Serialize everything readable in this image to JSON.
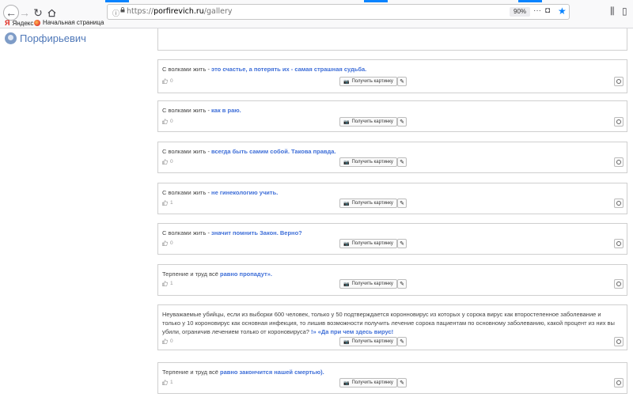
{
  "browser": {
    "url_scheme": "https://",
    "url_host": "porfirevich.ru",
    "url_path": "/gallery",
    "zoom": "90%",
    "bookmarks": [
      {
        "label": "Яндекс"
      },
      {
        "label": "Начальная страница"
      }
    ],
    "colors": {
      "accent": "#0a84ff"
    }
  },
  "site": {
    "logo_text": "Порфирьевич",
    "get_image_label": "Получить картинку"
  },
  "cards": [
    {
      "prompt": "С волками жить - ",
      "generated": "это счастье, а потерять их - самая страшная судьба.",
      "likes": "0"
    },
    {
      "prompt": "С волками жить - ",
      "generated": "как в раю.",
      "likes": "0"
    },
    {
      "prompt": "С волками жить - ",
      "generated": "всегда быть самим собой. Такова правда.",
      "likes": "0"
    },
    {
      "prompt": "С волками жить - ",
      "generated": "не гинекологию учить.",
      "likes": "1"
    },
    {
      "prompt": "С волками жить - ",
      "generated": "значит помнить Закон. Верно?",
      "likes": "0"
    },
    {
      "prompt": "Терпение и труд всё ",
      "generated": "равно пропадут».",
      "likes": "1"
    },
    {
      "prompt": "Неуважаемые убийцы, если из выборки 600 человек, только у 50 подтверждается коронновирус из которых у сорока вирус как второстепенное заболевание и только у 10 короновирус как основная инфекция, то лишив возможности получить лечение сорока пациентам по основному заболеванию, какой процент из них вы убили, ограничив лечением только от короновируса? ",
      "generated": "!» «Да при чем здесь вирус!",
      "likes": "0"
    },
    {
      "prompt": "Терпение и труд всё ",
      "generated": "равно закончится нашей смертью).",
      "likes": "1"
    }
  ]
}
